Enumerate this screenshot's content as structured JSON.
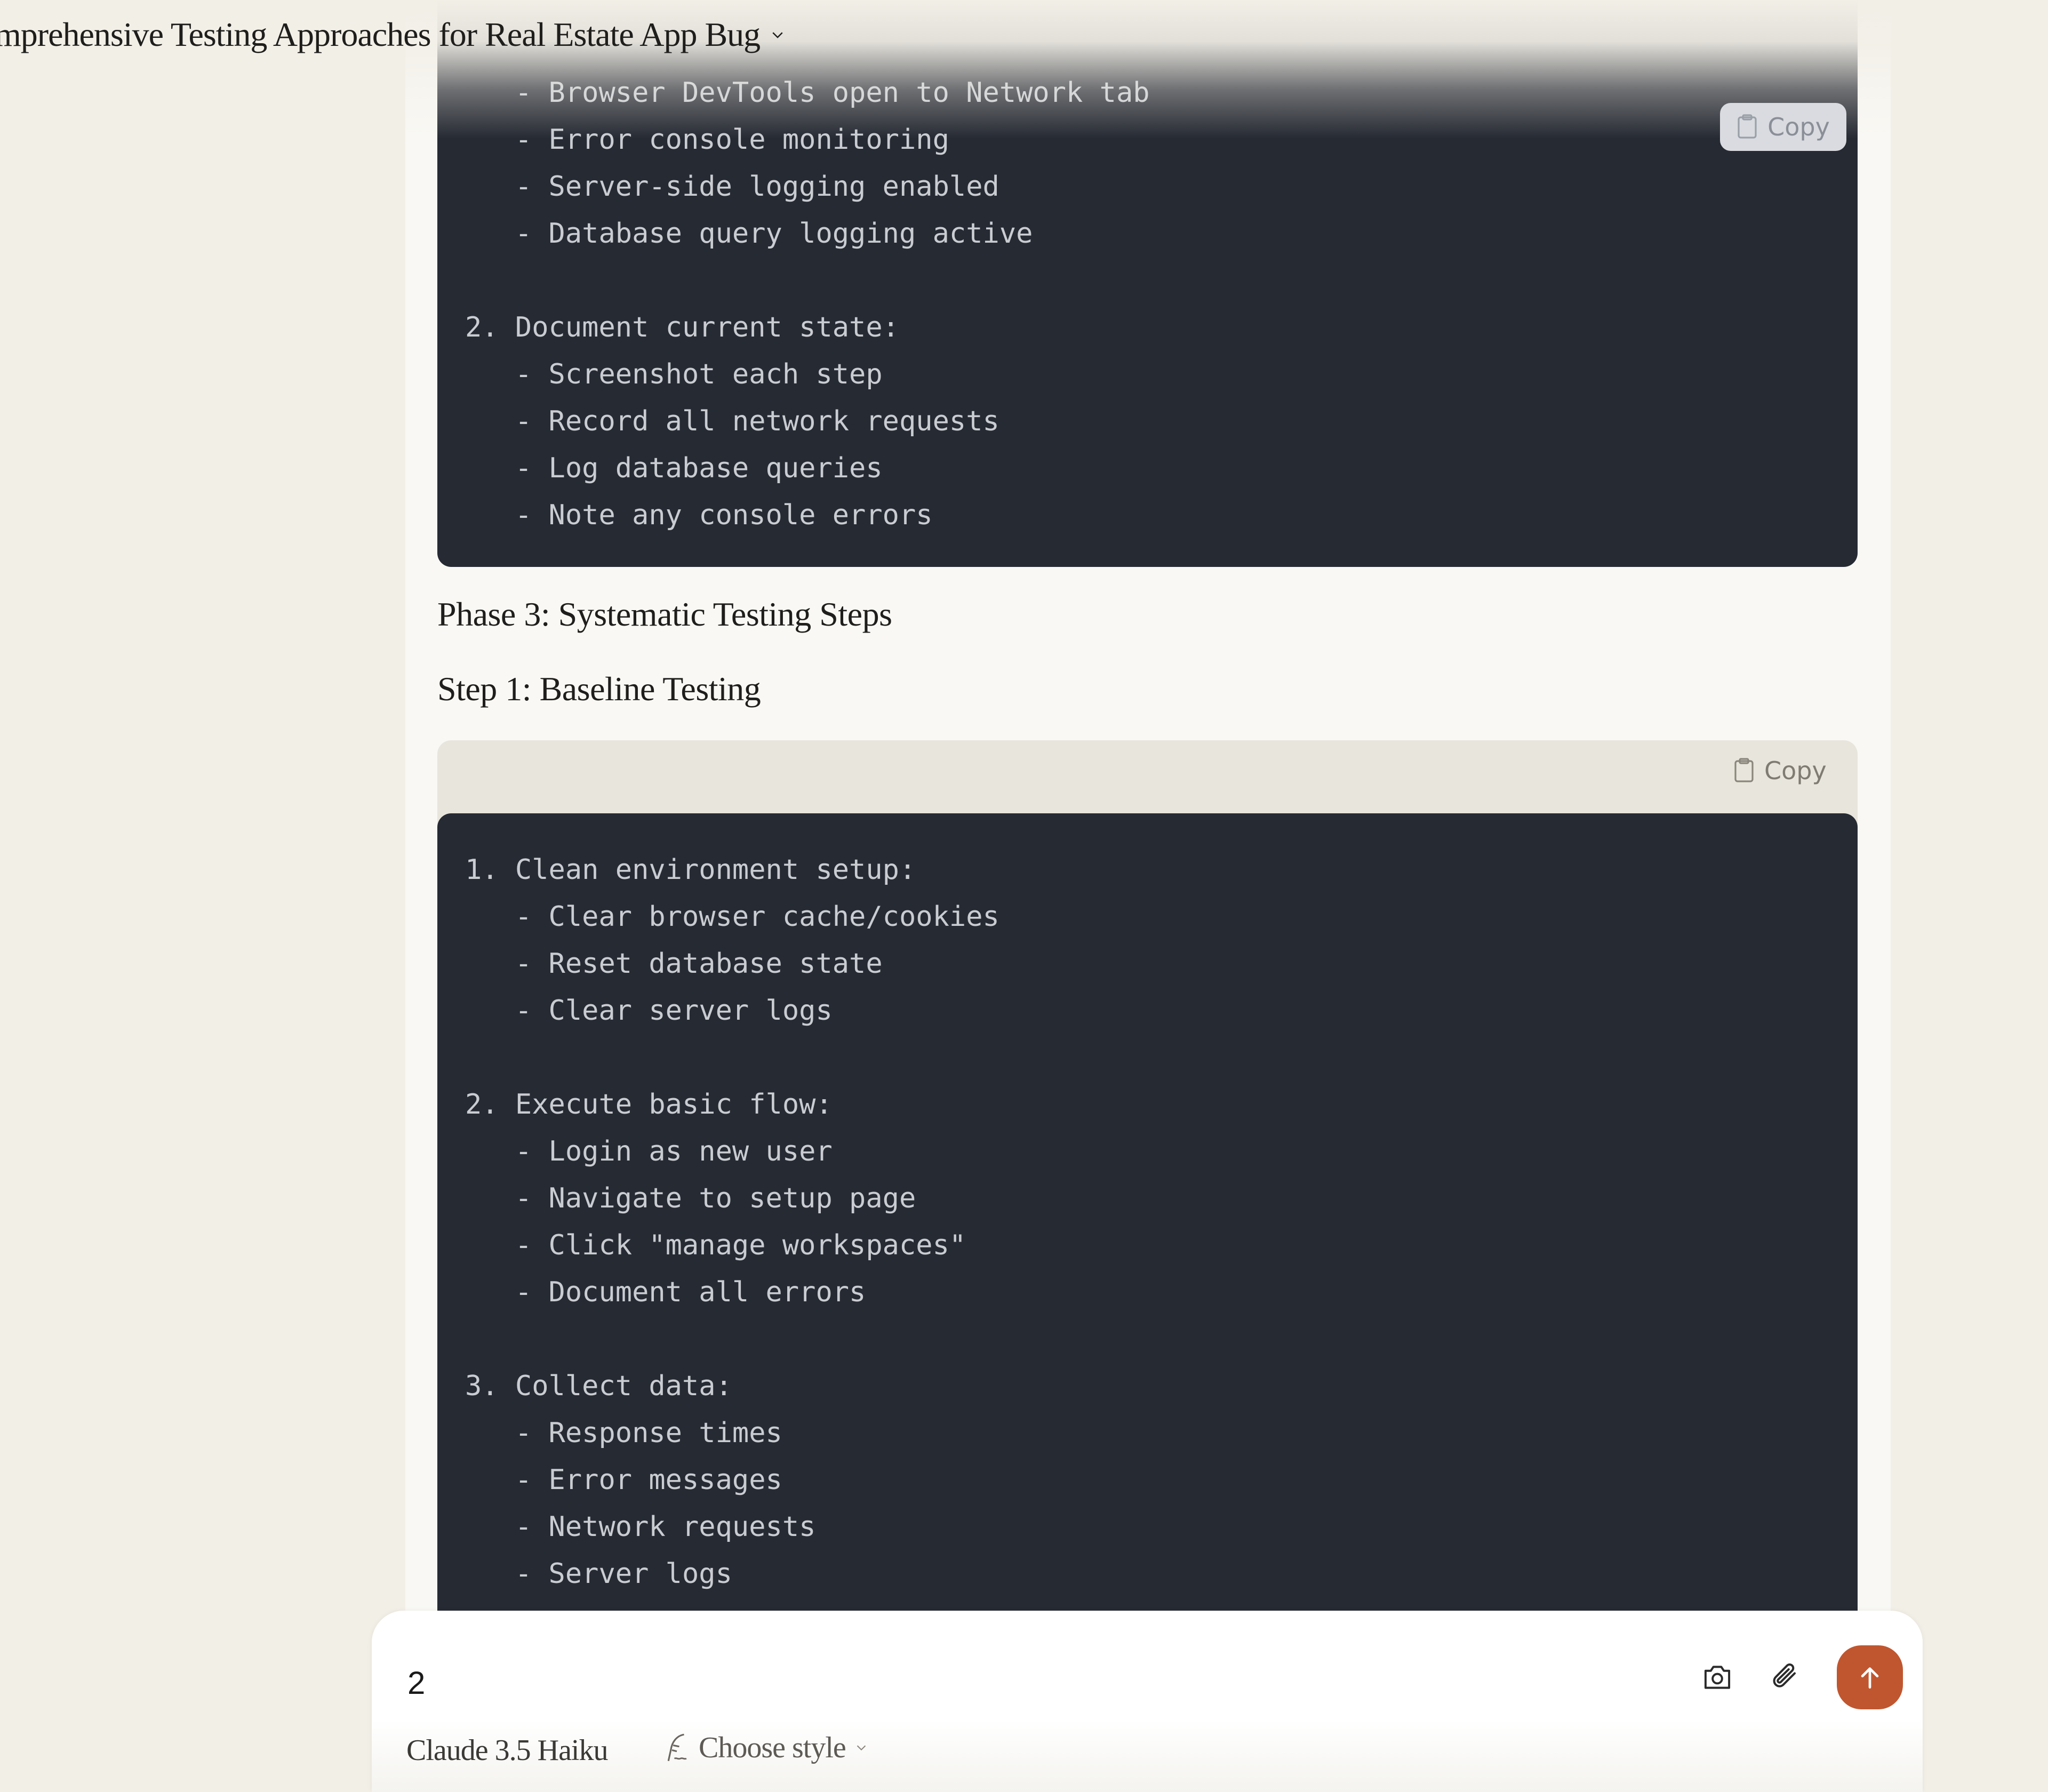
{
  "header": {
    "title": "mprehensive Testing Approaches for Real Estate App Bug",
    "chevron_icon": "chevron-down-icon"
  },
  "code_blocks": [
    {
      "copy_label": "Copy",
      "lines": [
        "   - Browser DevTools open to Network tab",
        "   - Error console monitoring",
        "   - Server-side logging enabled",
        "   - Database query logging active",
        "",
        "2. Document current state:",
        "   - Screenshot each step",
        "   - Record all network requests",
        "   - Log database queries",
        "   - Note any console errors"
      ]
    },
    {
      "copy_label": "Copy",
      "lines": [
        "1. Clean environment setup:",
        "   - Clear browser cache/cookies",
        "   - Reset database state",
        "   - Clear server logs",
        "",
        "2. Execute basic flow:",
        "   - Login as new user",
        "   - Navigate to setup page",
        "   - Click \"manage workspaces\"",
        "   - Document all errors",
        "",
        "3. Collect data:",
        "   - Response times",
        "   - Error messages",
        "   - Network requests",
        "   - Server logs"
      ]
    }
  ],
  "paragraphs": {
    "phase_heading": "Phase 3: Systematic Testing Steps",
    "step_heading": "Step 1: Baseline Testing"
  },
  "composer": {
    "input_value": "2",
    "model_label": "Claude 3.5 Haiku",
    "style_label": "Choose style",
    "send_color": "#c0562f"
  }
}
